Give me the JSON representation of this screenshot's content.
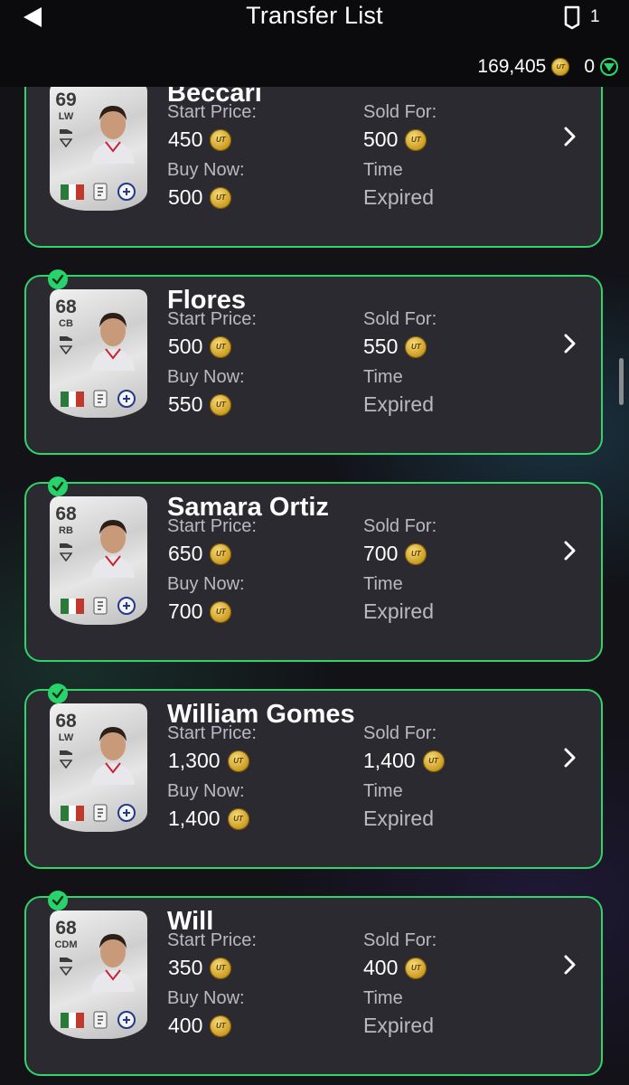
{
  "header": {
    "title": "Transfer List",
    "cards_count": "1",
    "coins": "169,405",
    "points": "0"
  },
  "labels": {
    "start_price": "Start Price:",
    "sold_for": "Sold For:",
    "buy_now": "Buy Now:",
    "time": "Time",
    "expired": "Expired",
    "coin_mark": "UT"
  },
  "items": [
    {
      "name": "Beccari",
      "rating": "69",
      "position": "LW",
      "start_price": "450",
      "sold_for": "500",
      "buy_now": "500"
    },
    {
      "name": "Flores",
      "rating": "68",
      "position": "CB",
      "start_price": "500",
      "sold_for": "550",
      "buy_now": "550"
    },
    {
      "name": "Samara Ortiz",
      "rating": "68",
      "position": "RB",
      "start_price": "650",
      "sold_for": "700",
      "buy_now": "700"
    },
    {
      "name": "William Gomes",
      "rating": "68",
      "position": "LW",
      "start_price": "1,300",
      "sold_for": "1,400",
      "buy_now": "1,400"
    },
    {
      "name": "Will",
      "rating": "68",
      "position": "CDM",
      "start_price": "350",
      "sold_for": "400",
      "buy_now": "400"
    }
  ],
  "colors": {
    "accent": "#2fd46a",
    "card_bg": "#2a2a30",
    "coin": "#d4a42a"
  }
}
